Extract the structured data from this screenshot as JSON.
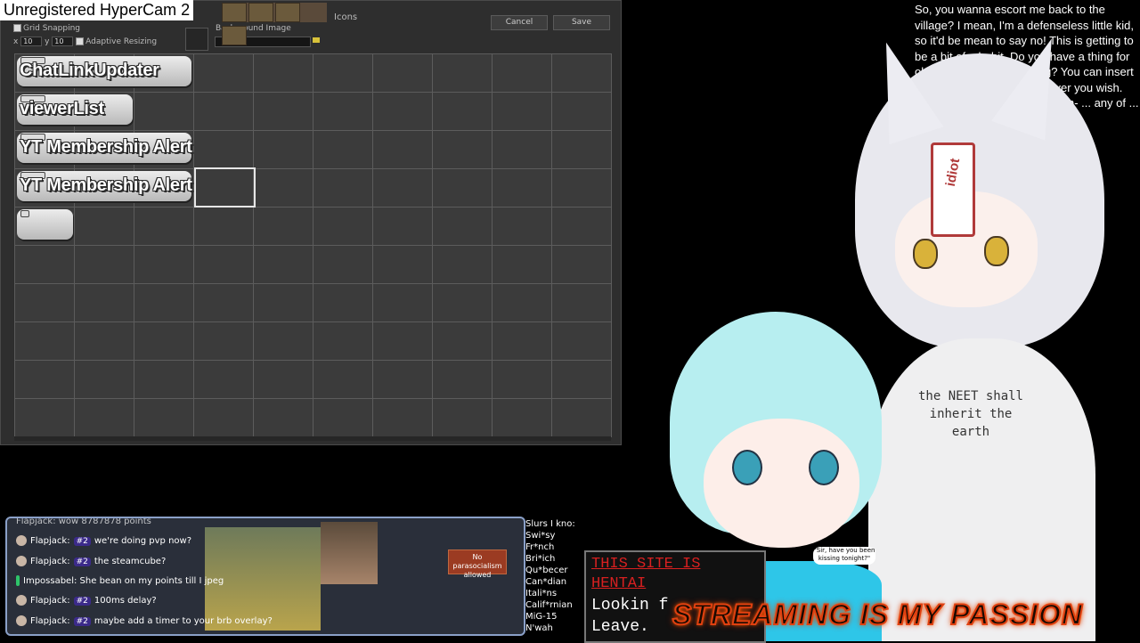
{
  "watermark": "Unregistered HyperCam 2",
  "editor": {
    "icons_label": "Icons",
    "cancel_label": "Cancel",
    "save_label": "Save",
    "grid_snapping_label": "Grid Snapping",
    "adaptive_resizing_label": "Adaptive Resizing",
    "x_label": "x",
    "x_value": "10",
    "y_label": "y",
    "y_value": "10",
    "background_image_label": "Background Image",
    "tiles": [
      "ChatLinkUpdater",
      "viewerList",
      "YT Membership Alert",
      "YT Membership Alert",
      ""
    ]
  },
  "chat": {
    "first_row": "Flapjack: wow 8787878 points",
    "rows": [
      {
        "user": "Flapjack:",
        "badge": "#2",
        "text": "we're doing pvp now?"
      },
      {
        "user": "Flapjack:",
        "badge": "#2",
        "text": "the steamcube?"
      },
      {
        "user": "Impossabel:",
        "badge": "",
        "text": "She bean on my points till I jpeg"
      },
      {
        "user": "Flapjack:",
        "badge": "#2",
        "text": "100ms delay?"
      },
      {
        "user": "Flapjack:",
        "badge": "#2",
        "text": "maybe add a timer to your brb overlay?"
      }
    ],
    "sign_text": "No parasocialism allowed"
  },
  "side_list": [
    "Slurs I kno:",
    "Swi*sy",
    "Fr*nch",
    "Bri*ich",
    "Qu*becer",
    "Can*dian",
    "Itali*ns",
    "Calif*rnian",
    "MiG-15",
    "N'wah"
  ],
  "story_text": "So, you wanna escort me back to the village? I mean, I'm a defenseless little kid, so it'd be mean to say no! This is getting to be a bit of a habit. Do you have a thing for older women or something? You can insert yourself into my story however you wish. Rare, well-done... nice medium- ... any of ... just...",
  "shirt_text": "the NEET shall inherit the earth",
  "idiot_tag": "idiot",
  "warning": {
    "line1": "THIS SITE IS",
    "line2": "HENTAI",
    "line3": "Lookin f",
    "line4": "Leave."
  },
  "sir_bubble": "\"Sir, have you been kissing tonight?\"",
  "banner_text": "STREAMING IS MY PASSION",
  "colors": {
    "editor_bg": "#2e2e2e",
    "grid_line": "#5c5c5c",
    "chat_border": "#8aa0c8",
    "warning_red": "#d82020",
    "banner_glow": "#ff6a00"
  }
}
